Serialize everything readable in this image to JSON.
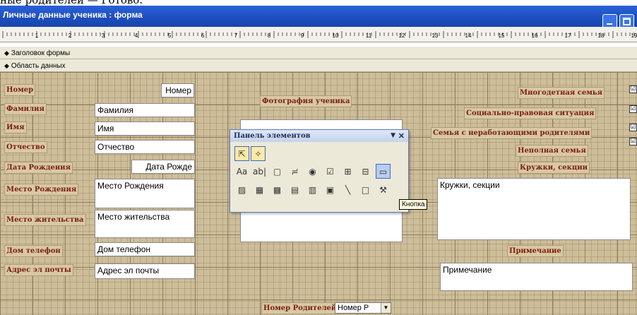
{
  "caption_text": "ные родителей — Готово.",
  "window": {
    "title": "Личные данные ученика : форма"
  },
  "ruler": {
    "numbers": [
      "1",
      "2",
      "3",
      "4",
      "5",
      "6",
      "7",
      "8",
      "9",
      "10",
      "11",
      "12",
      "13",
      "14",
      "15",
      "16",
      "17",
      "18",
      "19"
    ]
  },
  "sections": {
    "header": "Заголовок формы",
    "detail": "Область данных"
  },
  "labels": {
    "nomer": "Номер",
    "familiya": "Фамилия",
    "imya": "Имя",
    "otchestvo": "Отчество",
    "data_rozhd": "Дата Рождения",
    "mesto_rozhd": "Место Рождения",
    "mesto_zhit": "Место жительства",
    "dom_tel": "Дом телефон",
    "email": "Адрес эл почты",
    "photo": "Фотография ученика",
    "mnogodet": "Многодетная семья",
    "social": "Социально-правовая ситуация",
    "bezrab": "Семья с неработающими родителями",
    "nepoln": "Неполная семья",
    "kruzhki": "Кружки, секции",
    "primech": "Примечание",
    "nomer_rod": "Номер Родителей:"
  },
  "fields": {
    "nomer": "Номер",
    "familiya": "Фамилия",
    "imya": "Имя",
    "otchestvo": "Отчество",
    "data_rozhd": "Дата Рожде",
    "mesto_rozhd": "Место Рождения",
    "mesto_zhit": "Место жительства",
    "dom_tel": "Дом телефон",
    "email": "Адрес эл почты",
    "kruzhki": "Кружки, секции",
    "primech": "Примечание",
    "nomer_rod": "Номер Р"
  },
  "checkbox_mark": "☑",
  "toolbox": {
    "title": "Панель элементов",
    "dropdown_glyph": "▼",
    "close_glyph": "✕",
    "tools_row1": [
      "Aa",
      "ab|",
      "▢",
      "≓",
      "◉",
      "☑",
      "⊞",
      "⊟",
      "▭"
    ],
    "tools_row2": [
      "▨",
      "▦",
      "▩",
      "▤",
      "▥",
      "▣",
      "╲",
      "□",
      "⚒"
    ],
    "tooltip": "Кнопка"
  }
}
